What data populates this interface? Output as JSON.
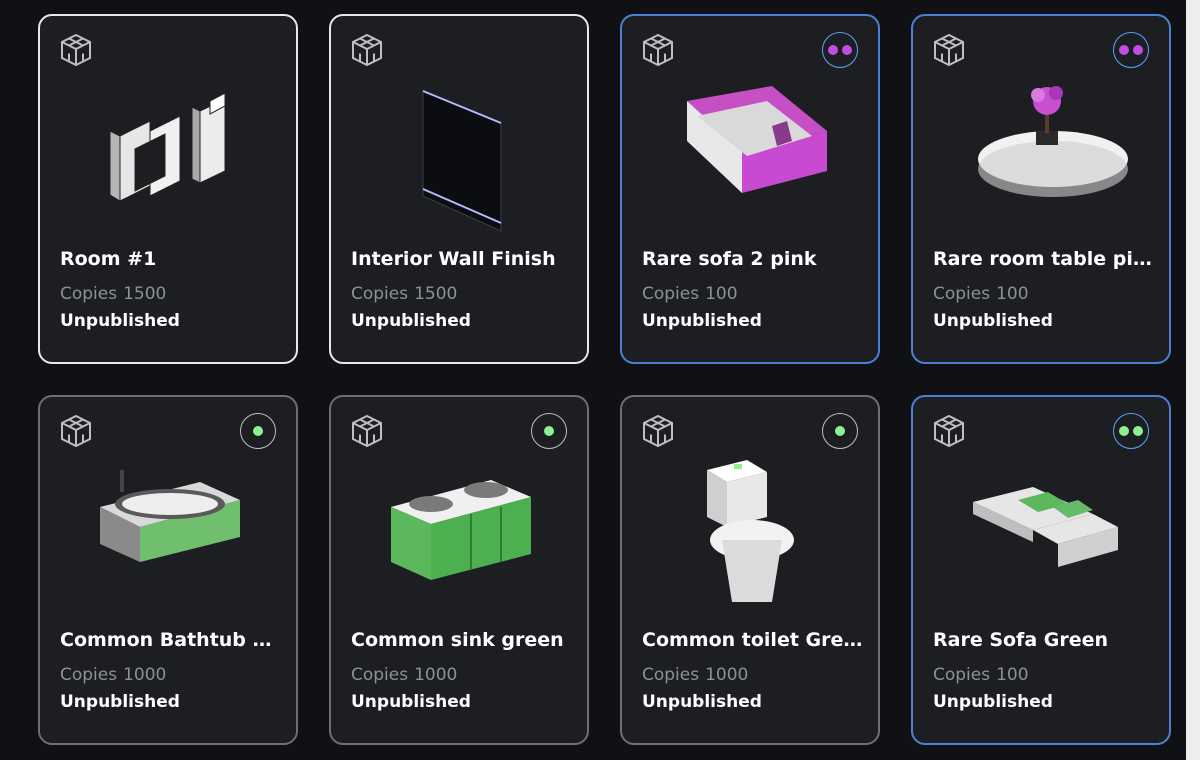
{
  "colors": {
    "rare_border": "#4a82d3",
    "common_border": "#6e6f71",
    "base_border": "#e8e8e8",
    "rare_dot": "#c04ee0",
    "rare_green_dot": "#8ef08e",
    "common_dot": "#8ef08e"
  },
  "cards": [
    {
      "title": "Room #1",
      "copies_label": "Copies",
      "copies": "1500",
      "status": "Unpublished",
      "tier": "base",
      "icon": "cube-icon"
    },
    {
      "title": "Interior Wall Finish",
      "copies_label": "Copies",
      "copies": "1500",
      "status": "Unpublished",
      "tier": "base",
      "icon": "cube-icon"
    },
    {
      "title": "Rare sofa 2 pink",
      "copies_label": "Copies",
      "copies": "100",
      "status": "Unpublished",
      "tier": "rare",
      "dot_color": "#c04ee0",
      "icon": "cube-icon"
    },
    {
      "title": "Rare room table pink",
      "copies_label": "Copies",
      "copies": "100",
      "status": "Unpublished",
      "tier": "rare",
      "dot_color": "#c04ee0",
      "icon": "cube-icon"
    },
    {
      "title": "Common Bathtub gr...",
      "copies_label": "Copies",
      "copies": "1000",
      "status": "Unpublished",
      "tier": "common",
      "dot_color": "#8ef08e",
      "icon": "cube-icon"
    },
    {
      "title": "Common sink green",
      "copies_label": "Copies",
      "copies": "1000",
      "status": "Unpublished",
      "tier": "common",
      "dot_color": "#8ef08e",
      "icon": "cube-icon"
    },
    {
      "title": "Common toilet Green",
      "copies_label": "Copies",
      "copies": "1000",
      "status": "Unpublished",
      "tier": "common",
      "dot_color": "#8ef08e",
      "icon": "cube-icon"
    },
    {
      "title": "Rare Sofa Green",
      "copies_label": "Copies",
      "copies": "100",
      "status": "Unpublished",
      "tier": "rare",
      "dot_color": "#8ef08e",
      "icon": "cube-icon"
    }
  ]
}
